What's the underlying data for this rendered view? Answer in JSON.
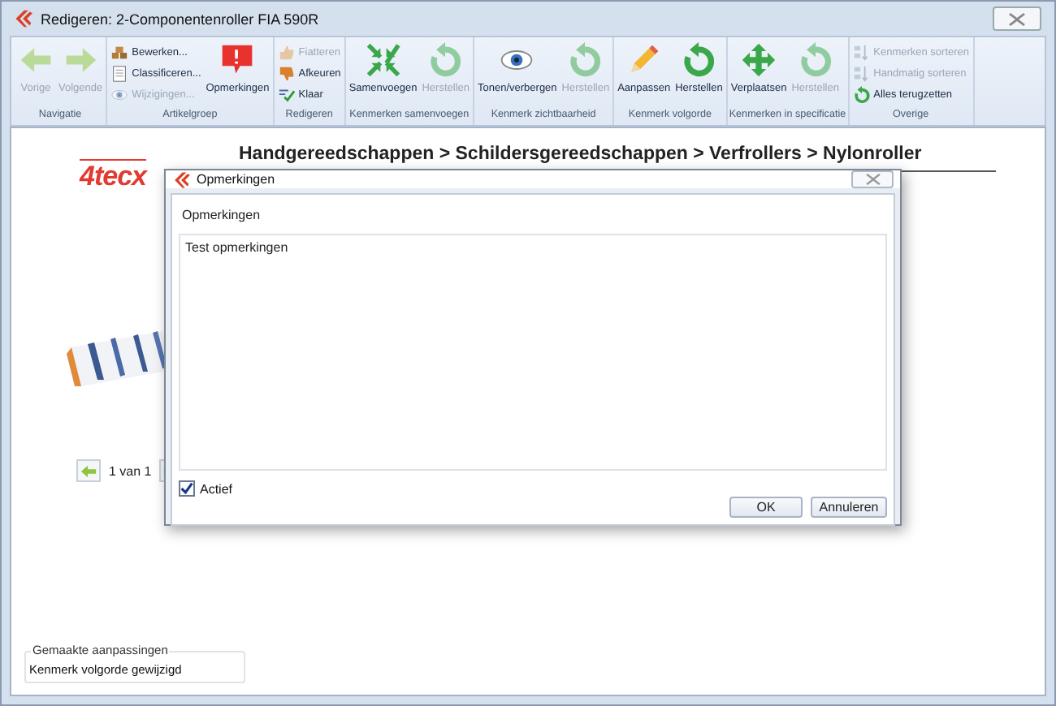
{
  "window": {
    "title": "Redigeren: 2-Componentenroller FIA 590R"
  },
  "ribbon": {
    "groups": [
      {
        "label": "Navigatie",
        "buttons": [
          {
            "kind": "large",
            "label": "Vorige",
            "disabled": true
          },
          {
            "kind": "large",
            "label": "Volgende",
            "disabled": true
          }
        ]
      },
      {
        "label": "Artikelgroep",
        "buttons": [
          {
            "kind": "small",
            "label": "Bewerken...",
            "disabled": false
          },
          {
            "kind": "small",
            "label": "Classificeren...",
            "disabled": false
          },
          {
            "kind": "small",
            "label": "Wijzigingen...",
            "disabled": true
          },
          {
            "kind": "large",
            "label": "Opmerkingen",
            "disabled": false
          }
        ]
      },
      {
        "label": "Redigeren",
        "buttons": [
          {
            "kind": "small",
            "label": "Fiatteren",
            "disabled": true
          },
          {
            "kind": "small",
            "label": "Afkeuren",
            "disabled": false
          },
          {
            "kind": "small",
            "label": "Klaar",
            "disabled": false
          }
        ]
      },
      {
        "label": "Kenmerken samenvoegen",
        "buttons": [
          {
            "kind": "large",
            "label": "Samenvoegen",
            "disabled": false
          },
          {
            "kind": "large",
            "label": "Herstellen",
            "disabled": true
          }
        ]
      },
      {
        "label": "Kenmerk zichtbaarheid",
        "buttons": [
          {
            "kind": "large",
            "label": "Tonen/verbergen",
            "disabled": false
          },
          {
            "kind": "large",
            "label": "Herstellen",
            "disabled": true
          }
        ]
      },
      {
        "label": "Kenmerk volgorde",
        "buttons": [
          {
            "kind": "large",
            "label": "Aanpassen",
            "disabled": false
          },
          {
            "kind": "large",
            "label": "Herstellen",
            "disabled": false
          }
        ]
      },
      {
        "label": "Kenmerken in specificatie",
        "buttons": [
          {
            "kind": "large",
            "label": "Verplaatsen",
            "disabled": false
          },
          {
            "kind": "large",
            "label": "Herstellen",
            "disabled": true
          }
        ]
      },
      {
        "label": "Overige",
        "buttons": [
          {
            "kind": "small",
            "label": "Kenmerken sorteren",
            "disabled": true
          },
          {
            "kind": "small",
            "label": "Handmatig sorteren",
            "disabled": true
          },
          {
            "kind": "small",
            "label": "Alles terugzetten",
            "disabled": false
          }
        ]
      }
    ]
  },
  "breadcrumb": "Handgereedschappen > Schildersgereedschappen > Verfrollers > Nylonroller",
  "logo": "4tecx",
  "pager": {
    "text": "1 van 1"
  },
  "dialog": {
    "title": "Opmerkingen",
    "field_label": "Opmerkingen",
    "value": "Test opmerkingen",
    "active": {
      "label": "Actief",
      "checked": true
    },
    "buttons": [
      "OK",
      "Annuleren"
    ]
  },
  "changes": {
    "legend": "Gemaakte aanpassingen",
    "value": "Kenmerk volgorde gewijzigd"
  }
}
